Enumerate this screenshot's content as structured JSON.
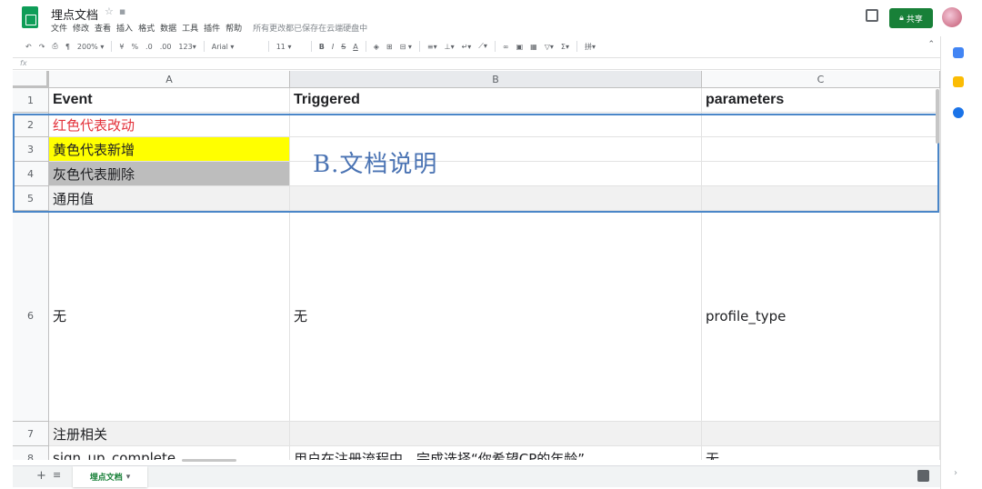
{
  "app": {
    "doc_title": "埋点文档",
    "menu": [
      "文件",
      "修改",
      "查看",
      "插入",
      "格式",
      "数据",
      "工具",
      "插件",
      "帮助"
    ],
    "save_status": "所有更改都已保存在云端硬盘中",
    "share_label": "共享"
  },
  "toolbar": {
    "zoom": "200%",
    "currency": "¥",
    "percent": "%",
    "dec_less": ".0",
    "dec_more": ".00",
    "number_format": "123",
    "font": "Arial",
    "font_size": "11",
    "bold": "B",
    "italic": "I",
    "strike": "S",
    "text_color": "A",
    "sum": "Σ"
  },
  "formula_bar": {
    "fx": "fx",
    "value": ""
  },
  "grid": {
    "columns": [
      "A",
      "B",
      "C"
    ],
    "rows": [
      {
        "num": "1",
        "a": "Event",
        "b": "Triggered",
        "c": "parameters"
      },
      {
        "num": "2",
        "a": "红色代表改动",
        "b": "",
        "c": ""
      },
      {
        "num": "3",
        "a": "黄色代表新增",
        "b": "",
        "c": ""
      },
      {
        "num": "4",
        "a": "灰色代表删除",
        "b": "",
        "c": ""
      },
      {
        "num": "5",
        "a": "通用值",
        "b": "",
        "c": ""
      },
      {
        "num": "6",
        "a": "无",
        "b": "无",
        "c": "profile_type"
      },
      {
        "num": "7",
        "a": "注册相关",
        "b": "",
        "c": ""
      },
      {
        "num": "8",
        "a": "sign_up_complete",
        "b": "用户在注册流程中，完成选择“你希望CP的年龄”",
        "c": "无"
      }
    ],
    "annotation": "B.文档说明"
  },
  "sheets": {
    "active": "埋点文档"
  },
  "colors": {
    "brand_green": "#0f9d58",
    "share_green": "#188038",
    "highlight_blue": "#4a86c8",
    "red_text": "#e3323b",
    "yellow_fill": "#ffff00",
    "gray_fill": "#bdbdbd"
  }
}
